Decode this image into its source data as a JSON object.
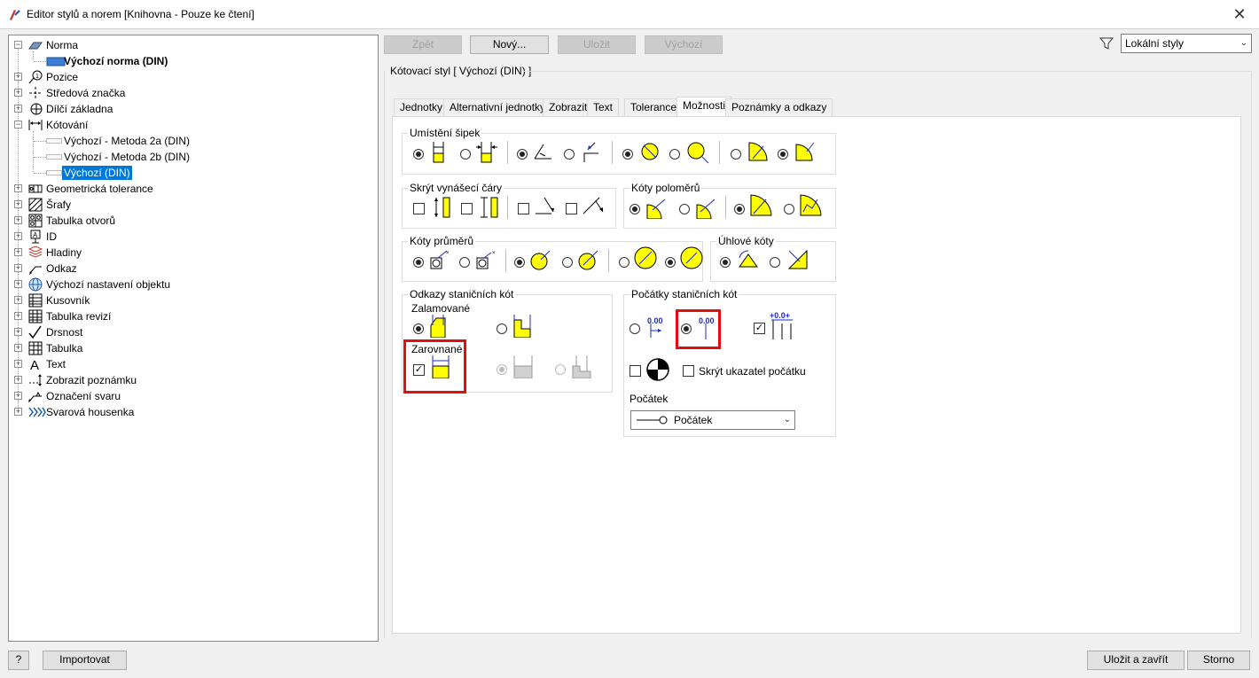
{
  "window": {
    "title": "Editor stylů a norem [Knihovna - Pouze ke čtení]",
    "close": "✕"
  },
  "tree": {
    "items": [
      {
        "label": "Norma"
      },
      {
        "label": "Výchozí norma (DIN)"
      },
      {
        "label": "Pozice"
      },
      {
        "label": "Středová značka"
      },
      {
        "label": "Dílčí základna"
      },
      {
        "label": "Kótování"
      },
      {
        "label": "Výchozí - Metoda 2a (DIN)"
      },
      {
        "label": "Výchozí - Metoda 2b (DIN)"
      },
      {
        "label": "Výchozí (DIN)"
      },
      {
        "label": "Geometrická tolerance"
      },
      {
        "label": "Šrafy"
      },
      {
        "label": "Tabulka otvorů"
      },
      {
        "label": "ID"
      },
      {
        "label": "Hladiny"
      },
      {
        "label": "Odkaz"
      },
      {
        "label": "Výchozí nastavení objektu"
      },
      {
        "label": "Kusovník"
      },
      {
        "label": "Tabulka revizí"
      },
      {
        "label": "Drsnost"
      },
      {
        "label": "Tabulka"
      },
      {
        "label": "Text"
      },
      {
        "label": "Zobrazit poznámku"
      },
      {
        "label": "Označení svaru"
      },
      {
        "label": "Svarová housenka"
      }
    ]
  },
  "toolbar": {
    "back": "Zpět",
    "new": "Nový...",
    "save": "Uložit",
    "default": "Výchozí",
    "filter_value": "Lokální styly"
  },
  "style_header": "Kótovací styl [ Výchozí (DIN) ]",
  "tabs": [
    "Jednotky",
    "Alternativní jednotky",
    "Zobrazit",
    "Text",
    "Tolerance",
    "Možnosti",
    "Poznámky a odkazy"
  ],
  "active_tab": "Možnosti",
  "groups": {
    "arrow_placement": "Umístění šipek",
    "hide_ext_lines": "Skrýt vynášecí čáry",
    "radius_dims": "Kóty poloměrů",
    "diameter_dims": "Kóty průměrů",
    "angular_dims": "Úhlové kóty",
    "ordinate_leaders": "Odkazy staničních kót",
    "jogged": "Zalamované",
    "aligned": "Zarovnané",
    "ordinate_origins": "Počátky staničních kót",
    "origin_value": "0.00",
    "origin_value_pm": "+0.0+",
    "hide_origin_indicator": "Skrýt ukazatel počátku",
    "origin_label": "Počátek",
    "origin_select": "Počátek"
  },
  "footer": {
    "help": "?",
    "import": "Importovat",
    "save_close": "Uložit a zavřít",
    "cancel": "Storno"
  },
  "colors": {
    "accent": "#0078d7",
    "symbol_fill": "#ffff00",
    "symbol_blue": "#1a28c8",
    "highlight": "#e01010"
  }
}
